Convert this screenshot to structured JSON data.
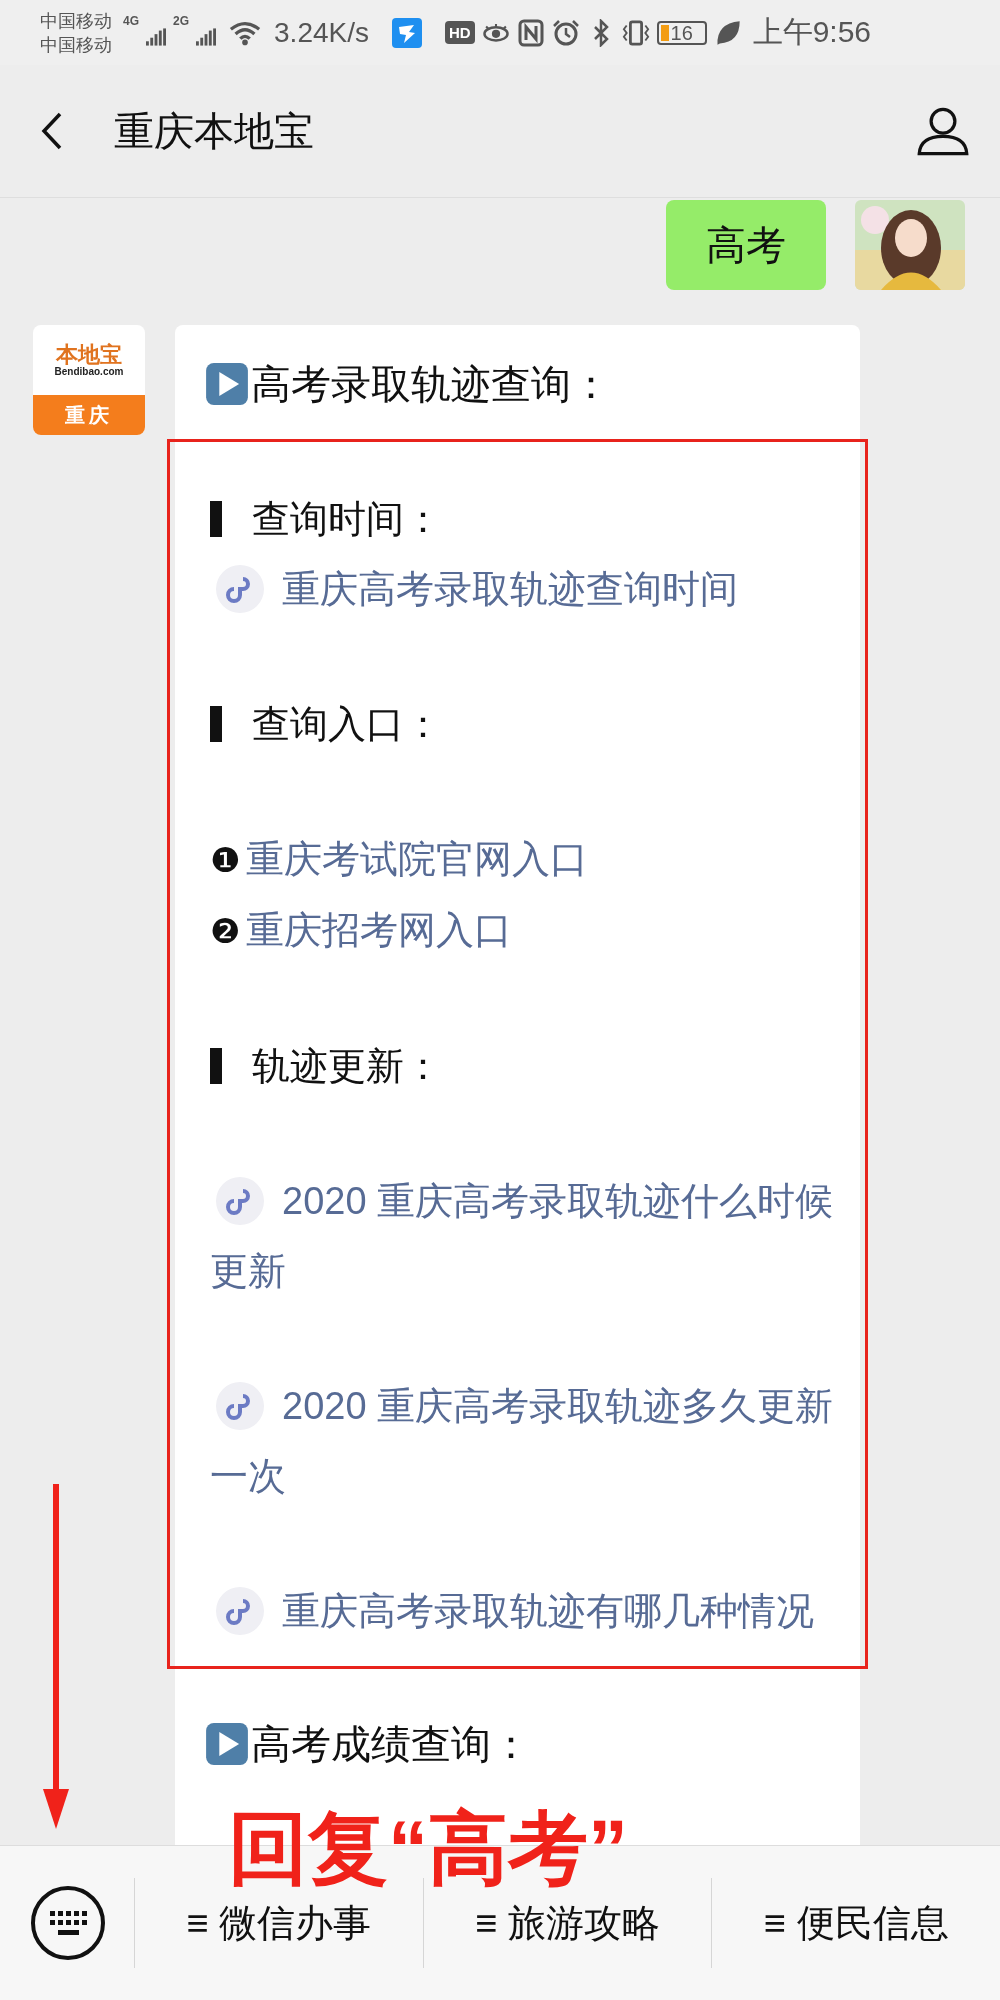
{
  "status_bar": {
    "carriers": [
      "中国移动",
      "中国移动"
    ],
    "networks": [
      "4G",
      "2G"
    ],
    "speed": "3.24K/s",
    "hd_badge": "HD",
    "battery": "16",
    "time": "上午9:56"
  },
  "nav": {
    "title": "重庆本地宝"
  },
  "outgoing": {
    "text": "高考"
  },
  "article": {
    "logo": {
      "brand": "本地宝",
      "domain": "Bendibao.com",
      "city": "重庆"
    },
    "heading": "高考录取轨迹查询：",
    "boxed": [
      {
        "kind": "section",
        "label": "查询时间：",
        "link": "重庆高考录取轨迹查询时间"
      },
      {
        "kind": "section",
        "label": "查询入口："
      },
      {
        "kind": "numbered",
        "marker": "❶",
        "link": "重庆考试院官网入口"
      },
      {
        "kind": "numbered",
        "marker": "❷",
        "link": "重庆招考网入口"
      },
      {
        "kind": "section",
        "label": "轨迹更新："
      },
      {
        "kind": "miniprogram",
        "link": "2020 重庆高考录取轨迹什么时候更新"
      },
      {
        "kind": "miniprogram",
        "link": "2020 重庆高考录取轨迹多久更新一次"
      },
      {
        "kind": "miniprogram",
        "link": "重庆高考录取轨迹有哪几种情况"
      }
    ],
    "next_heading": "高考成绩查询："
  },
  "annotation": {
    "text": "回复“高考”"
  },
  "menu": [
    {
      "glyph": "≡",
      "label": "微信办事"
    },
    {
      "glyph": "≡",
      "label": "旅游攻略"
    },
    {
      "glyph": "≡",
      "label": "便民信息"
    }
  ]
}
